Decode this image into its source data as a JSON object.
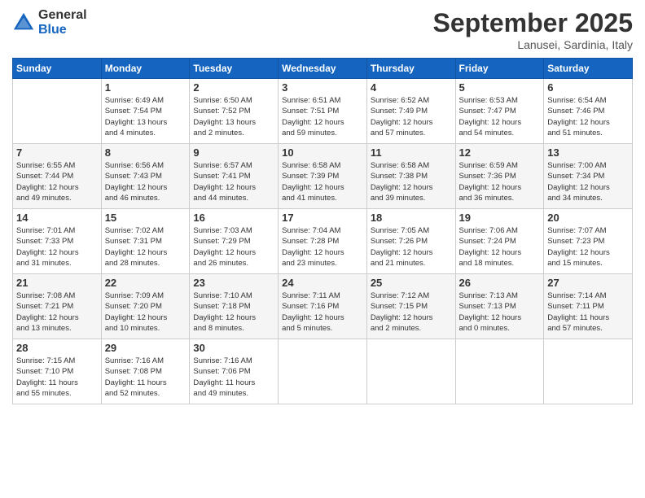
{
  "logo": {
    "general": "General",
    "blue": "Blue"
  },
  "header": {
    "month_year": "September 2025",
    "location": "Lanusei, Sardinia, Italy"
  },
  "days_of_week": [
    "Sunday",
    "Monday",
    "Tuesday",
    "Wednesday",
    "Thursday",
    "Friday",
    "Saturday"
  ],
  "weeks": [
    [
      {
        "day": "",
        "info": ""
      },
      {
        "day": "1",
        "info": "Sunrise: 6:49 AM\nSunset: 7:54 PM\nDaylight: 13 hours\nand 4 minutes."
      },
      {
        "day": "2",
        "info": "Sunrise: 6:50 AM\nSunset: 7:52 PM\nDaylight: 13 hours\nand 2 minutes."
      },
      {
        "day": "3",
        "info": "Sunrise: 6:51 AM\nSunset: 7:51 PM\nDaylight: 12 hours\nand 59 minutes."
      },
      {
        "day": "4",
        "info": "Sunrise: 6:52 AM\nSunset: 7:49 PM\nDaylight: 12 hours\nand 57 minutes."
      },
      {
        "day": "5",
        "info": "Sunrise: 6:53 AM\nSunset: 7:47 PM\nDaylight: 12 hours\nand 54 minutes."
      },
      {
        "day": "6",
        "info": "Sunrise: 6:54 AM\nSunset: 7:46 PM\nDaylight: 12 hours\nand 51 minutes."
      }
    ],
    [
      {
        "day": "7",
        "info": "Sunrise: 6:55 AM\nSunset: 7:44 PM\nDaylight: 12 hours\nand 49 minutes."
      },
      {
        "day": "8",
        "info": "Sunrise: 6:56 AM\nSunset: 7:43 PM\nDaylight: 12 hours\nand 46 minutes."
      },
      {
        "day": "9",
        "info": "Sunrise: 6:57 AM\nSunset: 7:41 PM\nDaylight: 12 hours\nand 44 minutes."
      },
      {
        "day": "10",
        "info": "Sunrise: 6:58 AM\nSunset: 7:39 PM\nDaylight: 12 hours\nand 41 minutes."
      },
      {
        "day": "11",
        "info": "Sunrise: 6:58 AM\nSunset: 7:38 PM\nDaylight: 12 hours\nand 39 minutes."
      },
      {
        "day": "12",
        "info": "Sunrise: 6:59 AM\nSunset: 7:36 PM\nDaylight: 12 hours\nand 36 minutes."
      },
      {
        "day": "13",
        "info": "Sunrise: 7:00 AM\nSunset: 7:34 PM\nDaylight: 12 hours\nand 34 minutes."
      }
    ],
    [
      {
        "day": "14",
        "info": "Sunrise: 7:01 AM\nSunset: 7:33 PM\nDaylight: 12 hours\nand 31 minutes."
      },
      {
        "day": "15",
        "info": "Sunrise: 7:02 AM\nSunset: 7:31 PM\nDaylight: 12 hours\nand 28 minutes."
      },
      {
        "day": "16",
        "info": "Sunrise: 7:03 AM\nSunset: 7:29 PM\nDaylight: 12 hours\nand 26 minutes."
      },
      {
        "day": "17",
        "info": "Sunrise: 7:04 AM\nSunset: 7:28 PM\nDaylight: 12 hours\nand 23 minutes."
      },
      {
        "day": "18",
        "info": "Sunrise: 7:05 AM\nSunset: 7:26 PM\nDaylight: 12 hours\nand 21 minutes."
      },
      {
        "day": "19",
        "info": "Sunrise: 7:06 AM\nSunset: 7:24 PM\nDaylight: 12 hours\nand 18 minutes."
      },
      {
        "day": "20",
        "info": "Sunrise: 7:07 AM\nSunset: 7:23 PM\nDaylight: 12 hours\nand 15 minutes."
      }
    ],
    [
      {
        "day": "21",
        "info": "Sunrise: 7:08 AM\nSunset: 7:21 PM\nDaylight: 12 hours\nand 13 minutes."
      },
      {
        "day": "22",
        "info": "Sunrise: 7:09 AM\nSunset: 7:20 PM\nDaylight: 12 hours\nand 10 minutes."
      },
      {
        "day": "23",
        "info": "Sunrise: 7:10 AM\nSunset: 7:18 PM\nDaylight: 12 hours\nand 8 minutes."
      },
      {
        "day": "24",
        "info": "Sunrise: 7:11 AM\nSunset: 7:16 PM\nDaylight: 12 hours\nand 5 minutes."
      },
      {
        "day": "25",
        "info": "Sunrise: 7:12 AM\nSunset: 7:15 PM\nDaylight: 12 hours\nand 2 minutes."
      },
      {
        "day": "26",
        "info": "Sunrise: 7:13 AM\nSunset: 7:13 PM\nDaylight: 12 hours\nand 0 minutes."
      },
      {
        "day": "27",
        "info": "Sunrise: 7:14 AM\nSunset: 7:11 PM\nDaylight: 11 hours\nand 57 minutes."
      }
    ],
    [
      {
        "day": "28",
        "info": "Sunrise: 7:15 AM\nSunset: 7:10 PM\nDaylight: 11 hours\nand 55 minutes."
      },
      {
        "day": "29",
        "info": "Sunrise: 7:16 AM\nSunset: 7:08 PM\nDaylight: 11 hours\nand 52 minutes."
      },
      {
        "day": "30",
        "info": "Sunrise: 7:16 AM\nSunset: 7:06 PM\nDaylight: 11 hours\nand 49 minutes."
      },
      {
        "day": "",
        "info": ""
      },
      {
        "day": "",
        "info": ""
      },
      {
        "day": "",
        "info": ""
      },
      {
        "day": "",
        "info": ""
      }
    ]
  ]
}
